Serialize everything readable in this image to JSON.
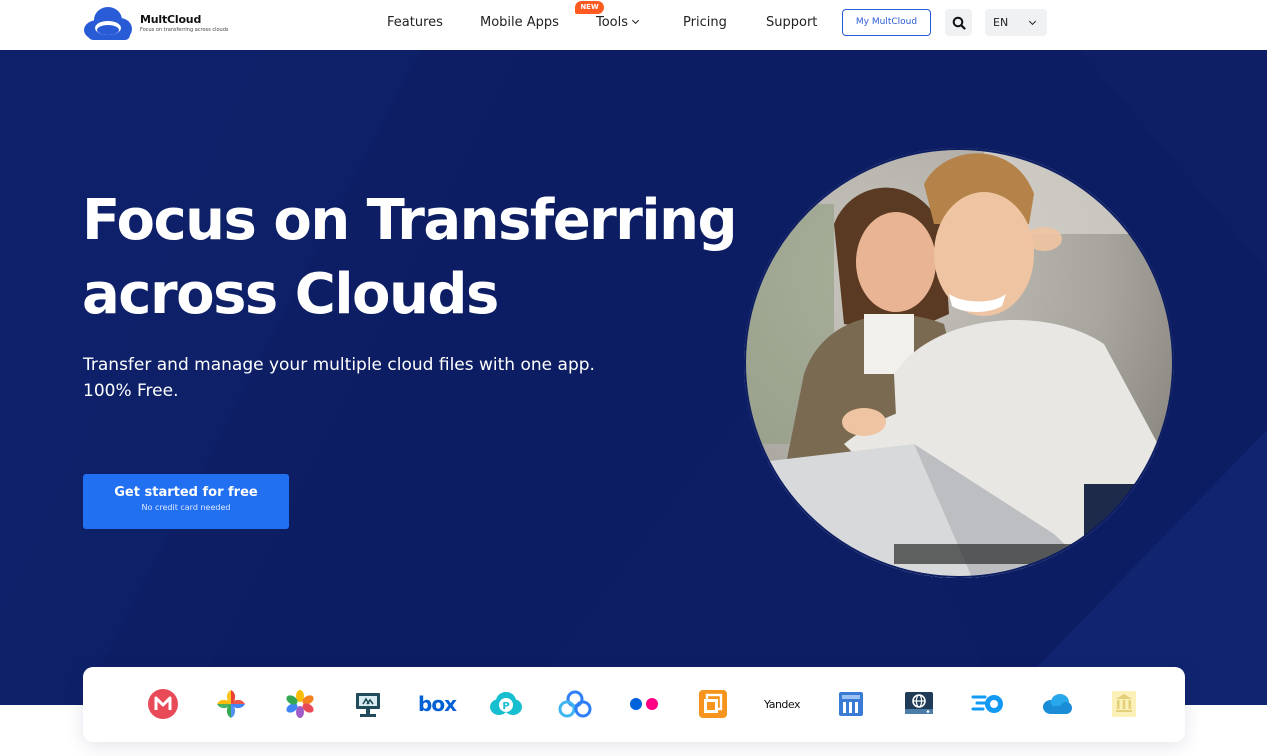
{
  "header": {
    "logo": {
      "name": "MultCloud",
      "tagline": "Focus on transferring across clouds"
    },
    "nav": [
      {
        "label": "Features"
      },
      {
        "label": "Mobile Apps"
      },
      {
        "label": "Tools",
        "badge": "NEW"
      },
      {
        "label": "Pricing"
      },
      {
        "label": "Support"
      }
    ],
    "my_button": "My MultCloud",
    "search_icon": "search-icon",
    "language": "EN"
  },
  "hero": {
    "title_line1": "Focus on Transferring",
    "title_line2": "across Clouds",
    "subtitle_line1": "Transfer and manage your multiple cloud files with one app.",
    "subtitle_line2": "100% Free.",
    "cta_label": "Get started for free",
    "cta_sublabel": "No credit card needed"
  },
  "clouds": {
    "icons": [
      "mega-icon",
      "google-photos-icon",
      "icloud-photos-icon",
      "ftp-icon",
      "box-icon",
      "pcloud-icon",
      "baidu-icon",
      "flickr-icon",
      "nas-icon",
      "yandex-icon",
      "wasabi-icon",
      "webdav-icon",
      "mediafire-icon",
      "onedrive-icon",
      "backblaze-icon"
    ],
    "box_label": "box",
    "yandex_label": "Yandex"
  },
  "colors": {
    "hero_bg": "#0c1d63",
    "accent": "#2270f2",
    "brand_blue": "#2a5bd7",
    "badge": "#ff5a1f"
  }
}
